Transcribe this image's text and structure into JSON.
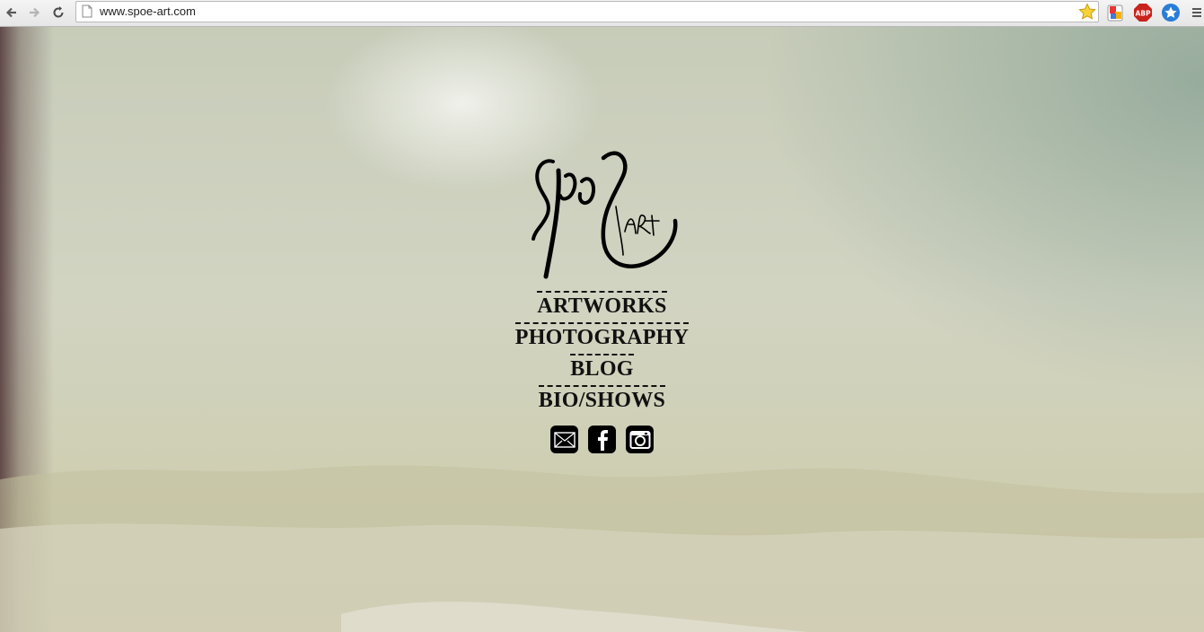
{
  "browser": {
    "url": "www.spoe-art.com",
    "icons": {
      "back": "back-arrow-icon",
      "forward": "forward-arrow-icon",
      "reload": "reload-icon",
      "page": "page-icon",
      "bookmark": "bookmark-star-icon",
      "extensions": [
        "extension-puzzle-icon",
        "adblock-plus-icon",
        "bookmark-extension-icon"
      ],
      "menu": "menu-icon"
    }
  },
  "site": {
    "menu": [
      {
        "label": "ARTWORKS"
      },
      {
        "label": "PHOTOGRAPHY"
      },
      {
        "label": "BLOG"
      },
      {
        "label": "BIO/SHOWS"
      }
    ],
    "social": [
      "email-icon",
      "facebook-icon",
      "instagram-icon"
    ],
    "colors": {
      "text": "#111111",
      "icon_bg": "#000000"
    }
  }
}
